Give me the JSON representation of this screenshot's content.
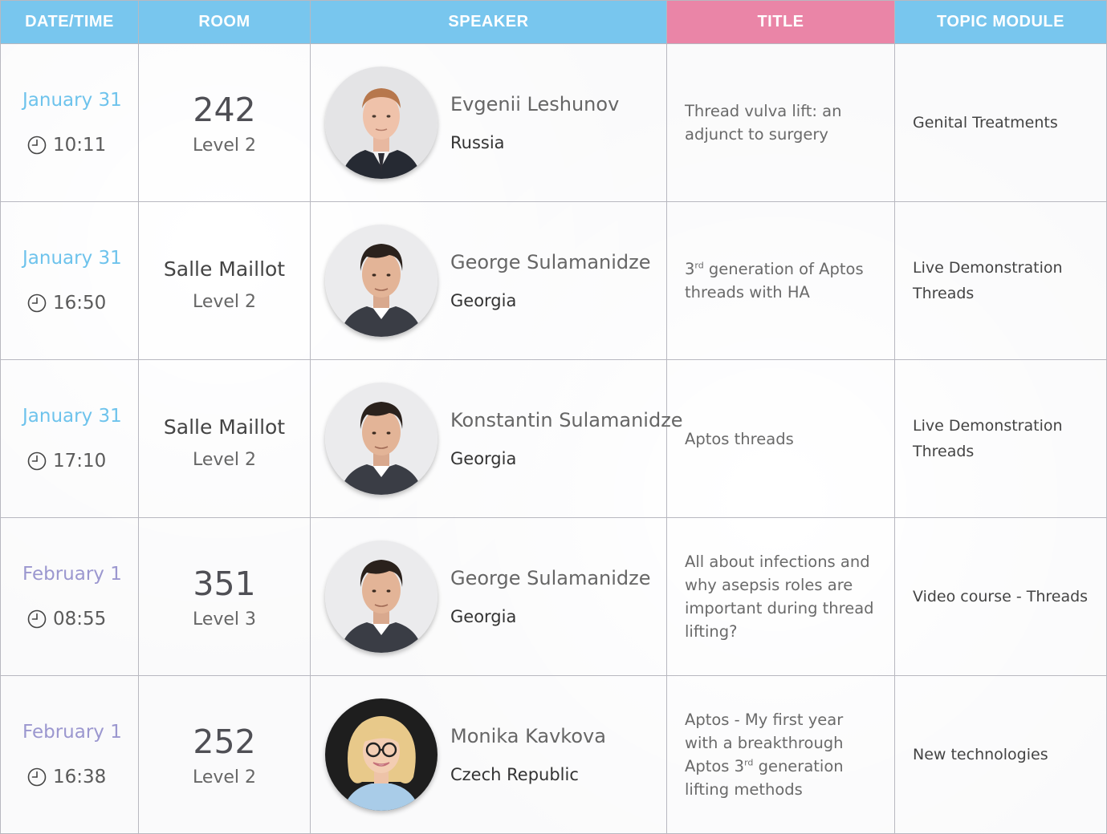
{
  "headers": {
    "date_time": "DATE/TIME",
    "room": "ROOM",
    "speaker": "SPEAKER",
    "title": "TITLE",
    "topic_module": "TOPIC MODULE"
  },
  "colors": {
    "header_blue": "#78c6ee",
    "header_pink": "#ea85a7",
    "january_date": "#6ec3ec",
    "february_date": "#9b97cf"
  },
  "rows": [
    {
      "date": "January 31",
      "time": "10:11",
      "room_number": "242",
      "room_name": "",
      "level": "Level 2",
      "speaker_name": "Evgenii Leshunov",
      "speaker_country": "Russia",
      "title_pre": "Thread vulva lift: an adjunct to surgery",
      "title_sup": "",
      "title_post": "",
      "topic": "Genital Treatments",
      "avatar_icon": "man-blond-avatar"
    },
    {
      "date": "January 31",
      "time": "16:50",
      "room_number": "",
      "room_name": "Salle Maillot",
      "level": "Level 2",
      "speaker_name": "George Sulamanidze",
      "speaker_country": "Georgia",
      "title_pre": "3",
      "title_sup": "rd",
      "title_post": " generation of Aptos threads with HA",
      "topic": "Live Demonstration Threads",
      "avatar_icon": "man-dark-hair-avatar"
    },
    {
      "date": "January 31",
      "time": "17:10",
      "room_number": "",
      "room_name": "Salle Maillot",
      "level": "Level 2",
      "speaker_name": "Konstantin Sulamanidze",
      "speaker_country": "Georgia",
      "title_pre": "Aptos threads",
      "title_sup": "",
      "title_post": "",
      "topic": "Live Demonstration Threads",
      "avatar_icon": "man-dark-hair-avatar"
    },
    {
      "date": "February 1",
      "time": "08:55",
      "room_number": "351",
      "room_name": "",
      "level": "Level 3",
      "speaker_name": "George Sulamanidze",
      "speaker_country": "Georgia",
      "title_pre": "All about infections and why asepsis roles are important during thread lifting?",
      "title_sup": "",
      "title_post": "",
      "topic": "Video course - Threads",
      "avatar_icon": "man-dark-hair-avatar"
    },
    {
      "date": "February 1",
      "time": "16:38",
      "room_number": "252",
      "room_name": "",
      "level": "Level 2",
      "speaker_name": "Monika Kavkova",
      "speaker_country": "Czech Republic",
      "title_pre": "Aptos - My first year with a breakthrough Aptos 3",
      "title_sup": "rd",
      "title_post": " generation lifting methods",
      "topic": "New technologies",
      "avatar_icon": "woman-blonde-glasses-avatar"
    }
  ]
}
